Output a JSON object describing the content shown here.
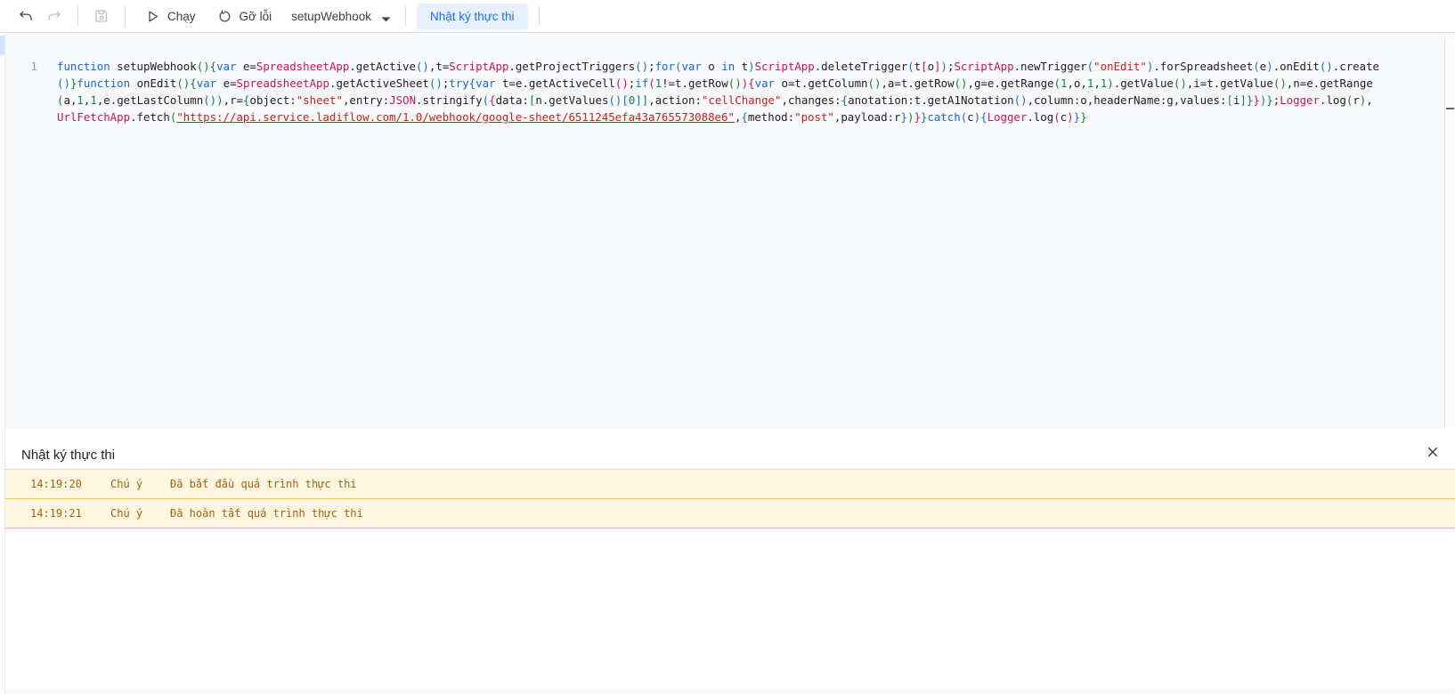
{
  "toolbar": {
    "run_label": "Chạy",
    "debug_label": "Gỡ lỗi",
    "function_name": "setupWebhook",
    "log_button_label": "Nhật ký thực thi",
    "icons": [
      "undo-icon",
      "redo-icon",
      "save-icon",
      "run-icon",
      "debug-icon",
      "chevron-down-icon"
    ],
    "accent_color": "#1a73e8",
    "log_button_bg": "#e8f0fe"
  },
  "editor": {
    "line_number": "1",
    "code_lines": [
      "function setupWebhook(){var e=SpreadsheetApp.getActive(),t=ScriptApp.getProjectTriggers();for(var o in t)ScriptApp.deleteTrigger(t[o]);ScriptApp.newTrigger(\"onEdit\").forSpreadsheet(e).onEdit().create",
      "()}function onEdit(){var e=SpreadsheetApp.getActiveSheet();try{var t=e.getActiveCell();if(1!=t.getRow()){var o=t.getColumn(),a=t.getRow(),g=e.getRange(1,o,1,1).getValue(),i=t.getValue(),n=e.getRange",
      "(a,1,1,e.getLastColumn()),r={object:\"sheet\",entry:JSON.stringify({data:[n.getValues()[0]],action:\"cellChange\",changes:{anotation:t.getA1Notation(),column:o,headerName:g,values:[i]}})};Logger.log(r),",
      "UrlFetchApp.fetch(\"https://api.service.ladiflow.com/1.0/webhook/google-sheet/6511245efa43a765573088e6\",{method:\"post\",payload:r})}}catch(c){Logger.log(c)}}"
    ],
    "syntax_colors": {
      "keyword": "#1967d2",
      "builtin": "#c2185b",
      "string": "#c5221f",
      "number": "#098658",
      "default": "#202124",
      "bracket_levels": [
        "#188038",
        "#1a6fc4",
        "#c2185b"
      ]
    },
    "keywords": [
      "function",
      "var",
      "for",
      "in",
      "if",
      "else",
      "try",
      "catch",
      "return",
      "new"
    ],
    "builtins": [
      "SpreadsheetApp",
      "ScriptApp",
      "JSON",
      "Logger",
      "UrlFetchApp"
    ]
  },
  "log_panel": {
    "title": "Nhật ký thực thi",
    "close_icon": "close-icon",
    "warning_bg": "#fdf7e2",
    "warning_border": "#f0c64f",
    "warning_text_color": "#a9600b",
    "rows": [
      {
        "time": "14:19:20",
        "level": "Chú ý",
        "message": "Đã bắt đầu quá trình thực thi"
      },
      {
        "time": "14:19:21",
        "level": "Chú ý",
        "message": "Đã hoàn tất quá trình thực thi"
      }
    ]
  }
}
